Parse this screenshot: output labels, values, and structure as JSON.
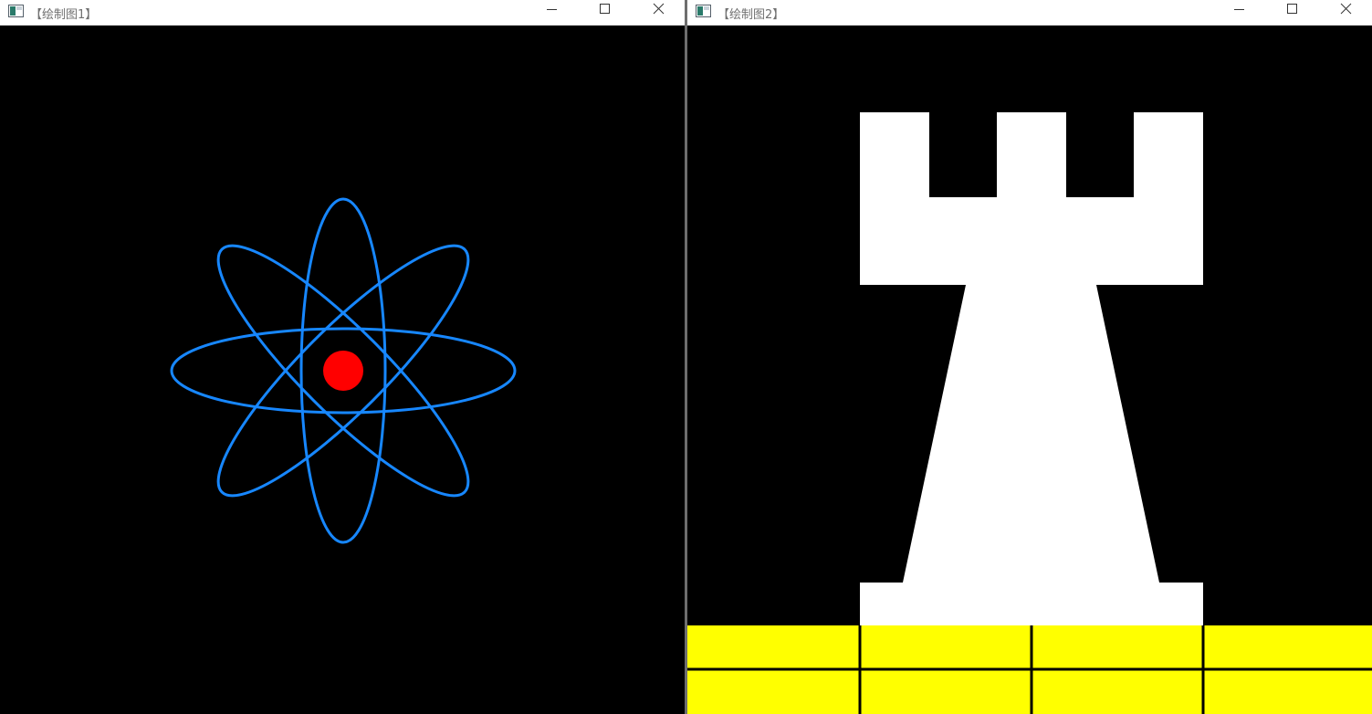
{
  "windows": [
    {
      "id": "w1",
      "title": "【绘制图1】",
      "controls": {
        "minimize": "minimize-icon",
        "maximize": "maximize-icon",
        "close": "close-icon"
      },
      "drawing": {
        "subject": "atom",
        "background_color": "#000000",
        "orbit_color": "#1787ff",
        "nucleus_color": "#ff0000",
        "orbit_count": 4,
        "orbit_angles_deg": [
          0,
          45,
          90,
          135
        ]
      }
    },
    {
      "id": "w2",
      "title": "【绘制图2】",
      "controls": {
        "minimize": "minimize-icon",
        "maximize": "maximize-icon",
        "close": "close-icon"
      },
      "drawing": {
        "subject": "rook",
        "background_color": "#000000",
        "rook_color": "#ffffff",
        "floor_color": "#ffff00",
        "floor_rows": 2,
        "floor_columns": 4,
        "grout_color": "#000000"
      }
    }
  ]
}
